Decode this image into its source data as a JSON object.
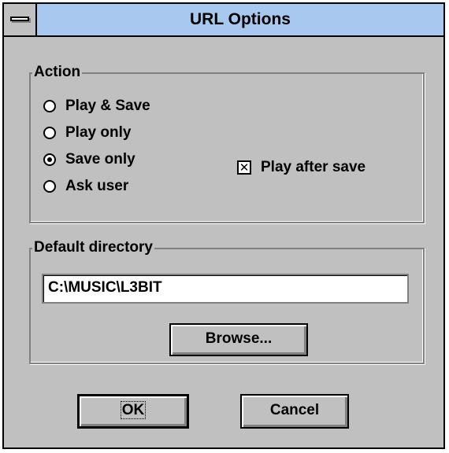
{
  "window": {
    "title": "URL Options"
  },
  "action": {
    "label": "Action",
    "options": [
      {
        "label": "Play & Save",
        "selected": false
      },
      {
        "label": "Play only",
        "selected": false
      },
      {
        "label": "Save only",
        "selected": true
      },
      {
        "label": "Ask user",
        "selected": false
      }
    ],
    "play_after_save": {
      "label": "Play after save",
      "checked": true,
      "mark": "✕"
    }
  },
  "directory": {
    "label": "Default directory",
    "value": "C:\\MUSIC\\L3BIT",
    "browse_label": "Browse..."
  },
  "buttons": {
    "ok_label": "OK",
    "cancel_label": "Cancel"
  }
}
